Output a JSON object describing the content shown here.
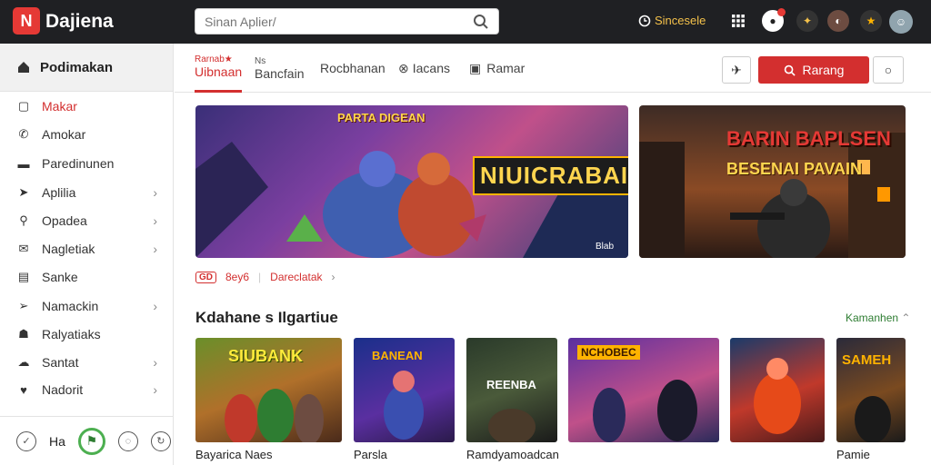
{
  "header": {
    "logo_letter": "N",
    "app_title": "Dajiena",
    "search_placeholder": "Sinan Aplier/",
    "top_link": "Sincesele"
  },
  "sidebar": {
    "heading": "Podimakan",
    "items": [
      {
        "label": "Makar",
        "icon": "square-icon"
      },
      {
        "label": "Amokar",
        "icon": "phone-icon"
      },
      {
        "label": "Paredinunen",
        "icon": "monitor-icon"
      },
      {
        "label": "Aplilia",
        "icon": "paper-plane-icon"
      },
      {
        "label": "Opadea",
        "icon": "search-icon"
      },
      {
        "label": "Nagletiak",
        "icon": "mail-icon"
      },
      {
        "label": "Sanke",
        "icon": "document-icon"
      },
      {
        "label": "Namackin",
        "icon": "send-icon"
      },
      {
        "label": "Ralyatiaks",
        "icon": "people-icon"
      },
      {
        "label": "Santat",
        "icon": "cloud-icon"
      },
      {
        "label": "Nadorit",
        "icon": "heart-icon"
      }
    ],
    "footer_label": "Ha"
  },
  "tabs": [
    {
      "label": "Uibnaan",
      "small": "Rarnab★"
    },
    {
      "label": "Bancfain",
      "small": "Ns"
    },
    {
      "label": "Rocbhanan",
      "small": ""
    },
    {
      "label": "Iacans",
      "small": ""
    },
    {
      "label": "Ramar",
      "small": ""
    }
  ],
  "actions": {
    "primary_label": "Rarang"
  },
  "banners": [
    {
      "title_top": "PARTA DIGEAN",
      "title_main": "NIUICRABAI",
      "badge": "Blab"
    },
    {
      "title_top": "BARIN BAPLSEN",
      "title_main": "BESENAI PAVAIN"
    }
  ],
  "meta_row": {
    "tag": "GD",
    "tag_text": "8ey6",
    "link": "Dareclatak"
  },
  "section": {
    "title": "Kdahane s Ilgartiue",
    "more": "Kamanhen"
  },
  "cards": [
    {
      "art": "SIUBANK",
      "label": "Bayarica Naes"
    },
    {
      "art": "BANEAN",
      "label": "Parsla"
    },
    {
      "art": "REENBA",
      "label": "Ramdyamoadcan"
    },
    {
      "art": "NCHOBEC",
      "label": ""
    },
    {
      "art": "",
      "label": ""
    },
    {
      "art": "SAMEH",
      "label": "Pamie"
    }
  ],
  "colors": {
    "accent": "#d32f2f",
    "topbar": "#1f2023",
    "green": "#2e7d32"
  }
}
